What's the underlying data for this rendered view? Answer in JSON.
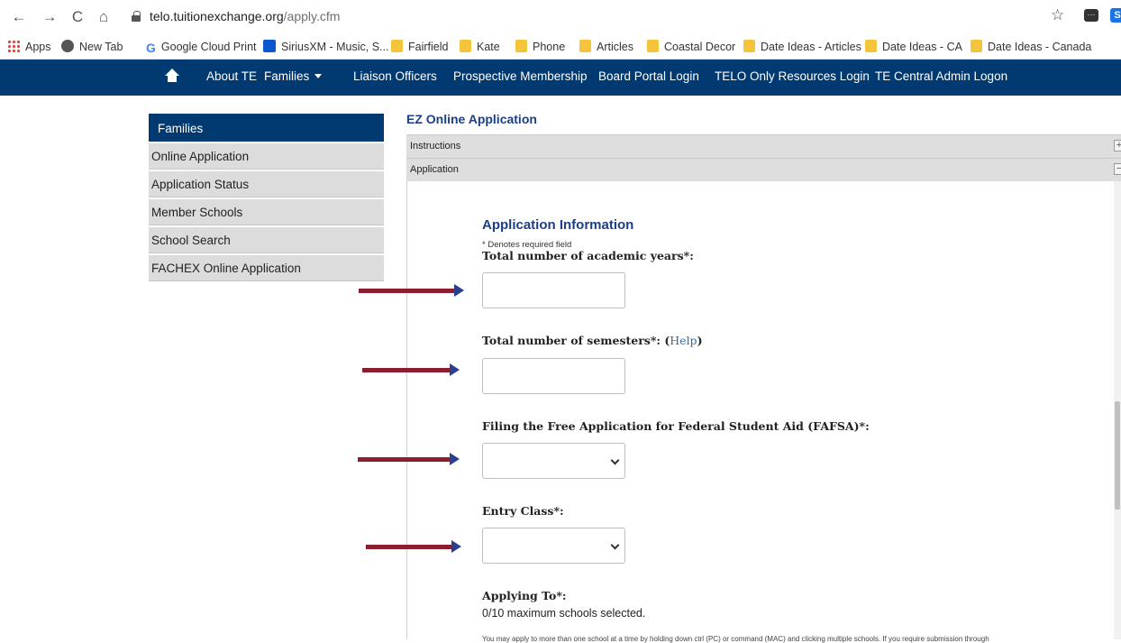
{
  "browser": {
    "url_domain": "telo.tuitionexchange.org",
    "url_path": "/apply.cfm",
    "back_glyph": "←",
    "forward_glyph": "→",
    "reload_glyph": "C",
    "home_glyph": "⌂",
    "star_glyph": "☆",
    "ext1_glyph": "···",
    "ext2_glyph": "S"
  },
  "bookmarks": [
    {
      "label": "Apps",
      "icon": "apps-grid-icon"
    },
    {
      "label": "New Tab",
      "icon": "globe-icon"
    },
    {
      "label": "Google Cloud Print",
      "icon": "google-g-icon"
    },
    {
      "label": "SiriusXM - Music, S...",
      "icon": "siriusxm-icon"
    },
    {
      "label": "Fairfield",
      "icon": "folder-icon"
    },
    {
      "label": "Kate",
      "icon": "folder-icon"
    },
    {
      "label": "Phone",
      "icon": "folder-icon"
    },
    {
      "label": "Articles",
      "icon": "folder-icon"
    },
    {
      "label": "Coastal Decor",
      "icon": "folder-icon"
    },
    {
      "label": "Date Ideas - Articles",
      "icon": "folder-icon"
    },
    {
      "label": "Date Ideas - CA",
      "icon": "folder-icon"
    },
    {
      "label": "Date Ideas - Canada",
      "icon": "folder-icon"
    }
  ],
  "site_nav": {
    "about": "About TE",
    "families": "Families",
    "liaison": "Liaison Officers",
    "prospective": "Prospective Membership",
    "board": "Board Portal Login",
    "telo": "TELO Only Resources Login",
    "admin": "TE Central Admin Logon"
  },
  "sidebar": {
    "heading": "Families",
    "items": [
      "Online Application",
      "Application Status",
      "Member Schools",
      "School Search",
      "FACHEX Online Application"
    ]
  },
  "main": {
    "title": "EZ Online Application",
    "accordion": {
      "instructions": "Instructions",
      "application": "Application",
      "expand_glyph": "+",
      "collapse_glyph": "−"
    },
    "section_title": "Application Information",
    "required_note": "* Denotes required field",
    "fields": {
      "years_label": "Total number of academic years*:",
      "years_value": "",
      "semesters_label": "Total number of semesters*: (",
      "semesters_help": "Help",
      "semesters_close": ")",
      "semesters_value": "",
      "fafsa_label": "Filing the Free Application for Federal Student Aid (FAFSA)*:",
      "fafsa_value": "",
      "entry_label": "Entry Class*:",
      "entry_value": "",
      "applying_label": "Applying To*:",
      "applying_count": "0/10 maximum schools selected."
    },
    "fine_print": "You may apply to more than one school at a time by holding down ctrl (PC) or command (MAC) and clicking multiple schools. If you require submission through"
  },
  "colors": {
    "nav_bg": "#003a70",
    "title_blue": "#1c3f84",
    "arrow_shaft": "#8b1e2f",
    "arrow_head": "#2b3f8f"
  }
}
